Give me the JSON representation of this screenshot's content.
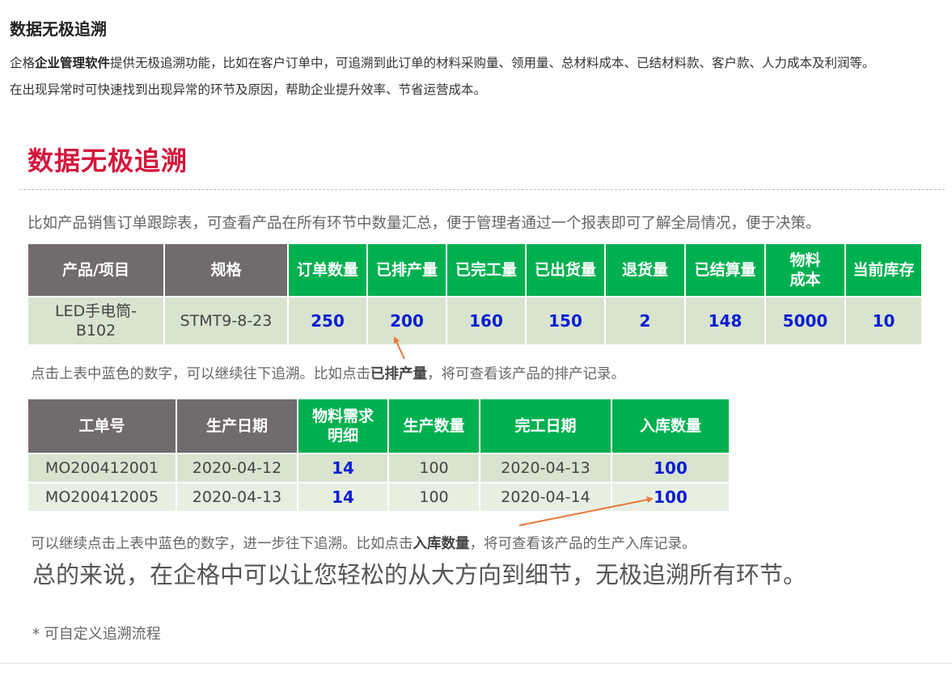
{
  "heading": "数据无极追溯",
  "intro": {
    "p1_pre": "企格",
    "p1_bold": "企业管理软件",
    "p1_post": "提供无极追溯功能，比如在客户订单中，可追溯到此订单的材料采购量、领用量、总材料成本、已结材料款、客户款、人力成本及利润等。",
    "p2": "在出现异常时可快速找到出现异常的环节及原因，帮助企业提升效率、节省运营成本。"
  },
  "banner": {
    "title": "数据无极追溯",
    "description": "比如产品销售订单跟踪表，可查看产品在所有环节中数量汇总，便于管理者通过一个报表即可了解全局情况，便于决策。"
  },
  "table1": {
    "headers": [
      "产品/项目",
      "规格",
      "订单数量",
      "已排产量",
      "已完工量",
      "已出货量",
      "退货量",
      "已结算量",
      "物料\n成本",
      "当前库存"
    ],
    "row": [
      "LED手电筒-B102",
      "STMT9-8-23",
      "250",
      "200",
      "160",
      "150",
      "2",
      "148",
      "5000",
      "10"
    ]
  },
  "note1": {
    "pre": "点击上表中蓝色的数字，可以继续往下追溯。比如点击",
    "bold": "已排产量",
    "post": "，将可查看该产品的排产记录。"
  },
  "table2": {
    "headers": [
      "工单号",
      "生产日期",
      "物料需求\n明细",
      "生产数量",
      "完工日期",
      "入库数量"
    ],
    "rows": [
      [
        "MO200412001",
        "2020-04-12",
        "14",
        "100",
        "2020-04-13",
        "100"
      ],
      [
        "MO200412005",
        "2020-04-13",
        "14",
        "100",
        "2020-04-14",
        "100"
      ]
    ]
  },
  "note2": {
    "pre": "可以继续点击上表中蓝色的数字，进一步往下追溯。比如点击",
    "bold": "入库数量",
    "post": "，将可查看该产品的生产入库记录。"
  },
  "summary": "总的来说，在企格中可以让您轻松的从大方向到细节，无极追溯所有环节。",
  "footnote": "* 可自定义追溯流程",
  "colors": {
    "header_gray": "#716b6c",
    "header_green": "#00b050",
    "number_blue": "#0b1ed2",
    "title_red": "#d4173d",
    "arrow_orange": "#e8793a"
  }
}
